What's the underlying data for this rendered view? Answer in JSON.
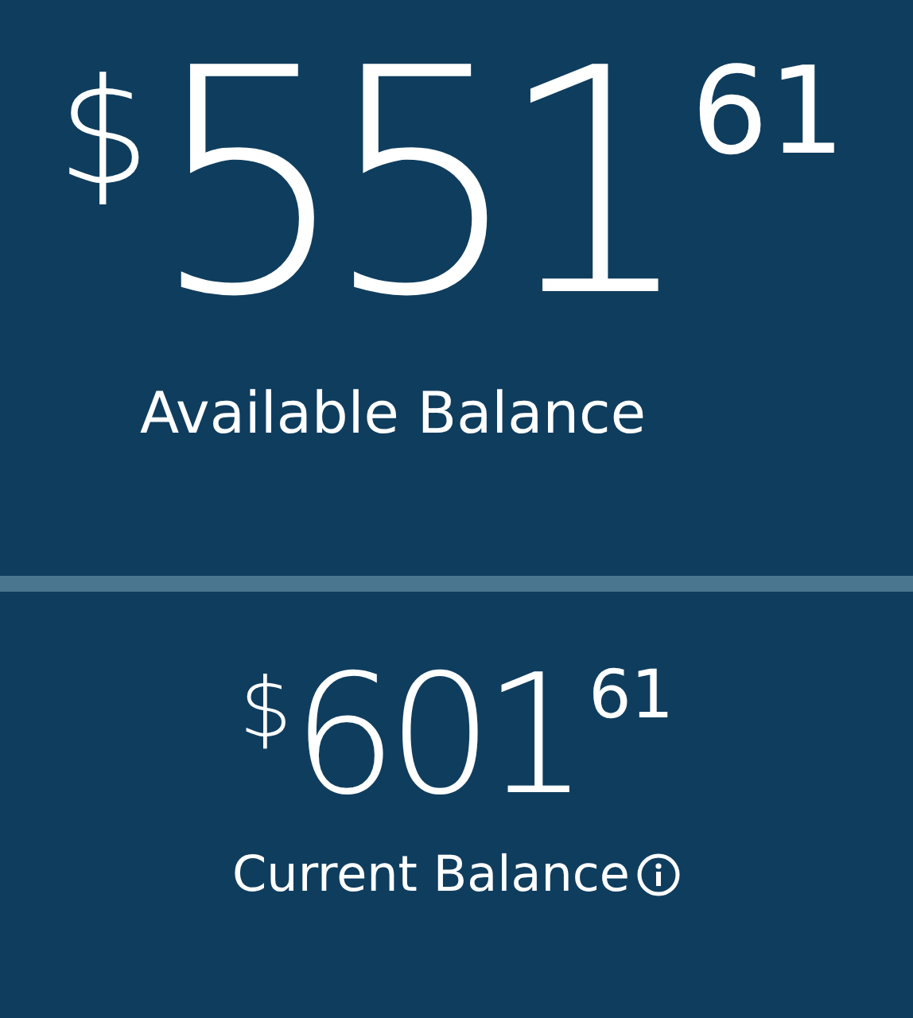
{
  "balances": [
    {
      "kind": "primary",
      "currency": "$",
      "whole": "551",
      "cents": "61",
      "label": "Available Balance",
      "info": false
    },
    {
      "kind": "secondary",
      "currency": "$",
      "whole": "601",
      "cents": "61",
      "label": "Current Balance",
      "info": true
    }
  ]
}
